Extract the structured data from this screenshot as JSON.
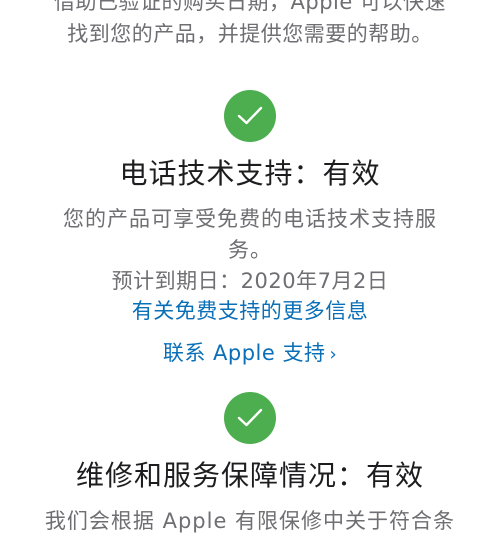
{
  "intro": {
    "line1": "借助已验证的购买日期，Apple 可以快速",
    "line2": "找到您的产品，并提供您需要的帮助。"
  },
  "phone_support": {
    "title": "电话技术支持：有效",
    "description": "您的产品可享受免费的电话技术支持服务。",
    "expiry": "预计到期日：2020年7月2日",
    "more_info_link": "有关免费支持的更多信息",
    "contact_link": "联系 Apple 支持",
    "contact_chevron": "›"
  },
  "repair_coverage": {
    "title": "维修和服务保障情况：有效",
    "description": "我们会根据 Apple 有限保修中关于符合条"
  },
  "colors": {
    "check_green": "#4cae4f",
    "link_blue": "#0a6fb7",
    "secondary_text": "#6e6e73"
  },
  "icons": {
    "status_icon": "checkmark-circle-icon"
  }
}
